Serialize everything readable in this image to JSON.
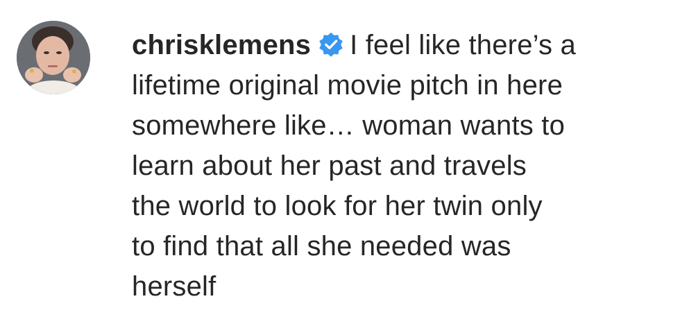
{
  "comment": {
    "username": "chrisklemens",
    "verified_icon": "verified-badge-icon",
    "verified_color": "#3897f0",
    "lines": [
      "I feel like there’s a",
      "lifetime original movie pitch in here",
      "somewhere like… woman wants to",
      "learn about her past and travels",
      "the world to look for her twin only",
      "to find that all she needed was",
      "herself"
    ]
  }
}
